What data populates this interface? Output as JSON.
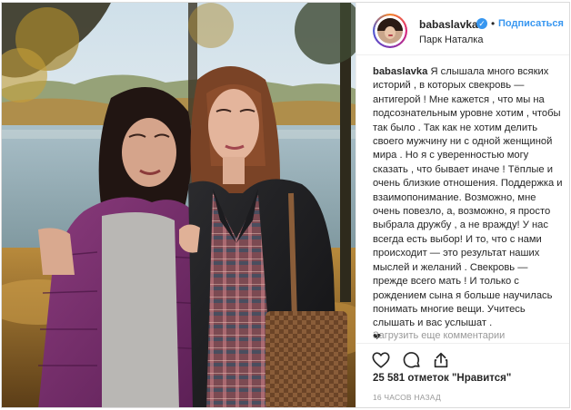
{
  "post": {
    "username": "babaslavka",
    "follow_label": "Подписаться",
    "dot": "•",
    "location": "Парк Наталка",
    "caption_author": "babaslavka",
    "caption_text": "Я слышала много всяких историй , в которых свекровь — антигерой ! Мне кажется , что мы на подсознательным уровне хотим , чтобы так было . Так как не хотим делить своего мужчину ни с одной женщиной мира . Но я с уверенностью могу сказать , что бывает иначе ! Тёплые и очень близкие отношения. Поддержка и взаимопонимание. Возможно, мне очень повезло, а, возможно, я просто выбрала дружбу , а не вражду! У нас всегда есть выбор! И то, что с нами происходит — это результат наших мыслей и желаний . Свекровь — прежде всего мать ! И только с рождением сына я больше научилась понимать многие вещи. Учитесь слышать и вас услышат .",
    "caption_heart": "❤",
    "load_more": "Загрузить еще комментарии",
    "likes": "25 581 отметок \"Нравится\"",
    "time": "16 ЧАСОВ НАЗАД",
    "verified_icon": "checkmark-icon",
    "colors": {
      "link_blue": "#3897f0",
      "text": "#262626",
      "muted": "#999999",
      "border": "#efefef"
    },
    "icons": [
      "heart-icon",
      "comment-icon",
      "share-icon"
    ]
  }
}
